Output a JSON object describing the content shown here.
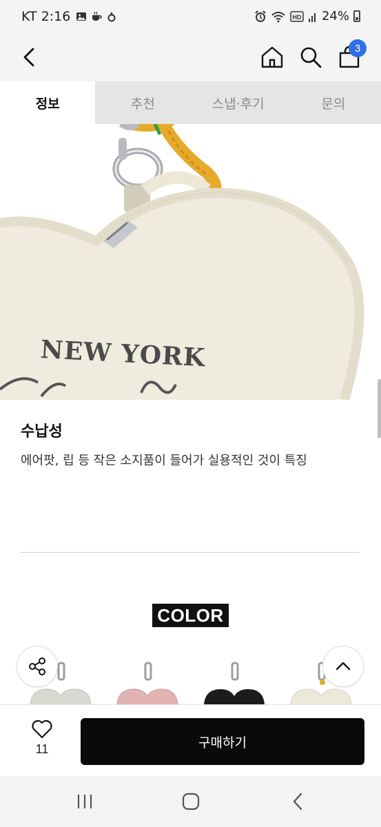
{
  "status_bar": {
    "carrier_time": "KT 2:16",
    "battery": "24%",
    "left_icons": [
      "gallery-icon",
      "coffee-icon",
      "notification-icon"
    ],
    "right_icons": [
      "alarm-icon",
      "wifi-icon",
      "hd-icon",
      "signal-icon",
      "battery-icon"
    ]
  },
  "header": {
    "back_icon": "chevron-left-icon",
    "home_icon": "home-icon",
    "search_icon": "search-icon",
    "cart_icon": "shopping-bag-icon",
    "cart_badge": "3",
    "accent_color": "#2f6fe4"
  },
  "tabs": [
    {
      "label": "정보",
      "active": true
    },
    {
      "label": "추천",
      "active": false
    },
    {
      "label": "스냅·후기",
      "active": false
    },
    {
      "label": "문의",
      "active": false
    }
  ],
  "product_image": {
    "print_text": "NEW YORK"
  },
  "section": {
    "title": "수납성",
    "description": "에어팟, 립 등 작은 소지품이 들어가 실용적인 것이 특징"
  },
  "color_label": "COLOR",
  "swatches": [
    {
      "name": "gray",
      "color": "#d9d9d2"
    },
    {
      "name": "pink",
      "color": "#e2b3b3"
    },
    {
      "name": "black",
      "color": "#1c1c1c"
    },
    {
      "name": "ivory",
      "color": "#ece9dc"
    }
  ],
  "floating": {
    "share_icon": "share-icon",
    "top_icon": "chevron-up-icon"
  },
  "bottom_bar": {
    "like_icon": "heart-icon",
    "like_count": "11",
    "buy_label": "구매하기"
  },
  "nav_bar": {
    "recents_icon": "recents-icon",
    "home_icon": "home-nav-icon",
    "back_icon": "back-nav-icon"
  }
}
